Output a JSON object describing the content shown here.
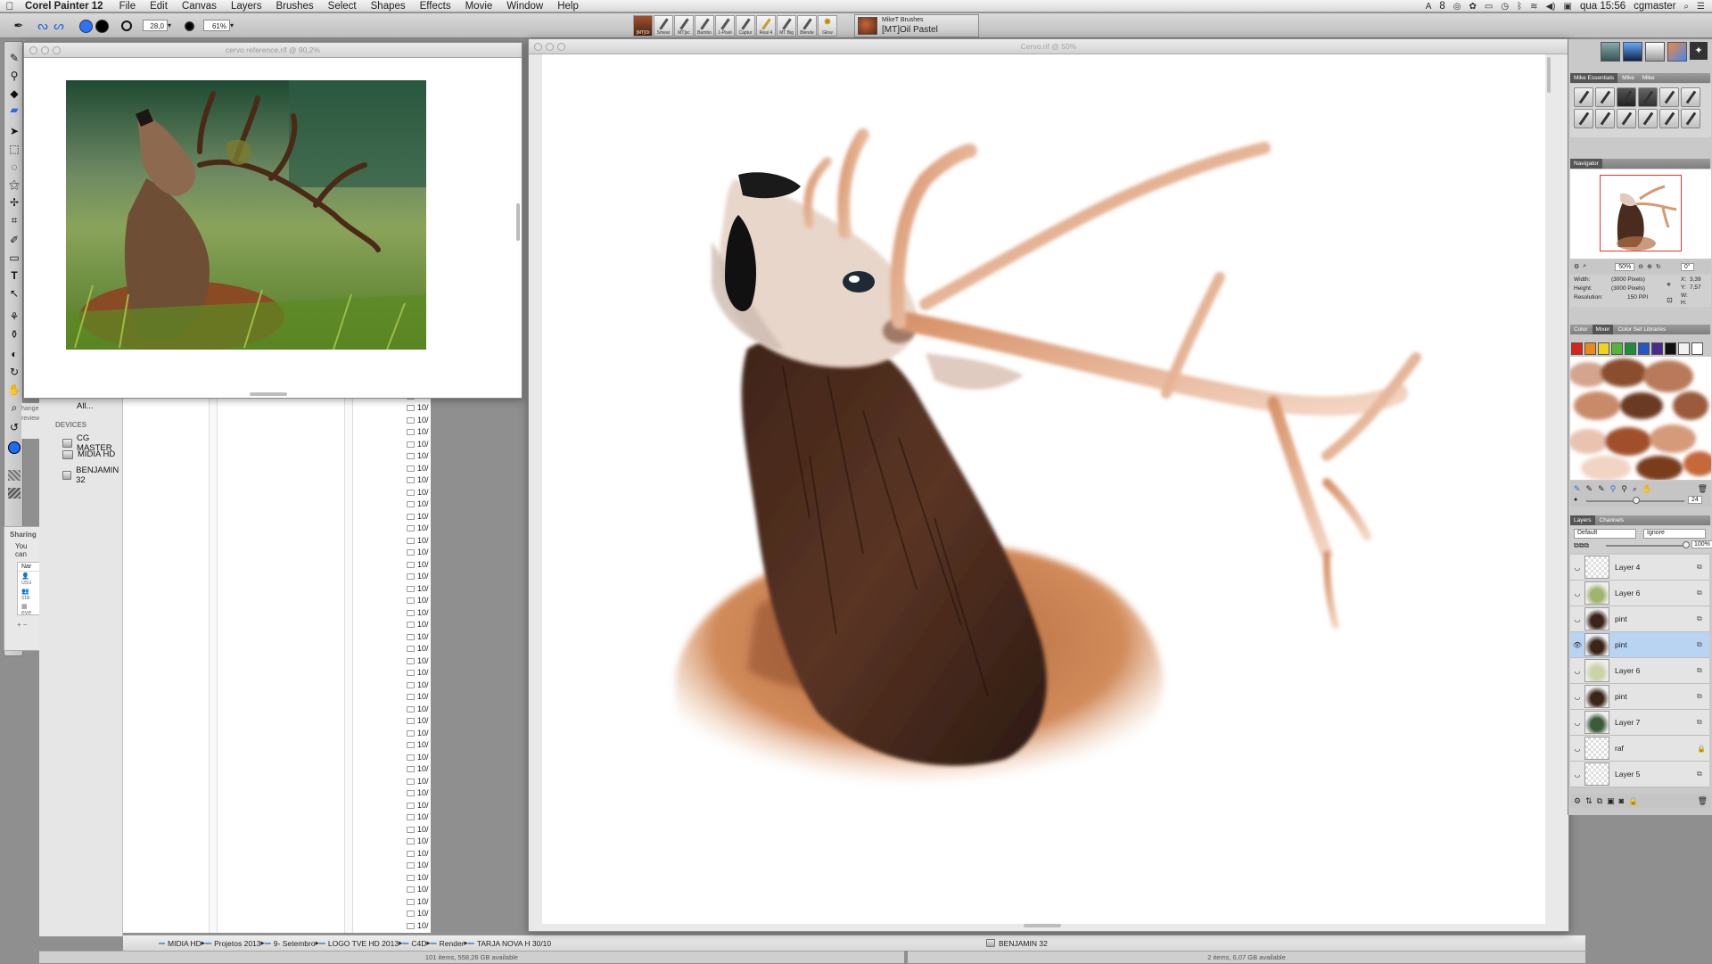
{
  "menubar": {
    "app_name": "Corel Painter 12",
    "items": [
      "File",
      "Edit",
      "Canvas",
      "Layers",
      "Brushes",
      "Select",
      "Shapes",
      "Effects",
      "Movie",
      "Window",
      "Help"
    ],
    "status_count": "8",
    "clock": "qua 15:56",
    "user": "cgmaster"
  },
  "propbar": {
    "size_value": "28,0",
    "opacity_value": "61%",
    "brush_slots": [
      "[MT]Oi",
      "Smear",
      "MT]sc",
      "Bambo",
      "1-Pixel",
      "Captur",
      "Real 4",
      "MT Big",
      "Blende",
      "Glow"
    ],
    "library_title": "MikeT Brushes",
    "brush_name": "[MT]Oil Pastel"
  },
  "ref_window": {
    "title": "cervo reference.rif @ 90,2%"
  },
  "main_window": {
    "title": "Cervo.rif @ 50%"
  },
  "finder": {
    "all_label": "All...",
    "devices_header": "DEVICES",
    "devices": [
      "CG MASTER",
      "MIDIA HD",
      "BENJAMIN 32"
    ],
    "date_prefix": "10/",
    "sharing_title": "Sharing",
    "sharing_text": "You can",
    "sharing_col": "Nar",
    "sharing_users": [
      "usu",
      "sta",
      "eve"
    ],
    "side_fragments": [
      "hange",
      "review"
    ],
    "path": [
      "MIDIA HD",
      "Projetos 2013",
      "9- Setembro",
      "LOGO TVE HD 2013",
      "C4D",
      "Render",
      "TARJA NOVA H 30/10"
    ],
    "status_left": "101 items, 558,26 GB available",
    "path_right": "BENJAMIN 32",
    "status_right": "2 items, 6,07 GB available"
  },
  "panels": {
    "brush_tabs": [
      "Mike Essentials",
      "Mike",
      "Mike"
    ],
    "navigator_title": "Navigator",
    "nav_zoom": "50%",
    "nav_angle": "0°",
    "info": {
      "width_label": "Width:",
      "width_value": "(3000 Pixels)",
      "height_label": "Height:",
      "height_value": "(3000 Pixels)",
      "res_label": "Resolution:",
      "res_value": "150 PPI",
      "x_label": "X:",
      "x_value": "3,39",
      "y_label": "Y:",
      "y_value": "7,57",
      "w_label": "W:",
      "h_label": "H:"
    },
    "color_tabs": [
      "Color",
      "Mixer",
      "Color Set Libraries"
    ],
    "mixer_swatches": [
      "#d8231b",
      "#e98a1a",
      "#efd41c",
      "#57b43a",
      "#1f8d3c",
      "#2757c5",
      "#4a2b8c",
      "#111111",
      "#f2f2f2",
      "#ffffff"
    ],
    "mixer_value": "24",
    "layers_tabs": [
      "Layers",
      "Channels"
    ],
    "blend_mode": "Default",
    "composite": "Ignore",
    "layer_opacity": "100%",
    "layers": [
      {
        "name": "Layer 4",
        "selected": false,
        "locked": false
      },
      {
        "name": "Layer 6",
        "selected": false,
        "locked": false
      },
      {
        "name": "pint",
        "selected": false,
        "locked": false
      },
      {
        "name": "pint",
        "selected": true,
        "locked": false
      },
      {
        "name": "Layer 6",
        "selected": false,
        "locked": false
      },
      {
        "name": "pint",
        "selected": false,
        "locked": false
      },
      {
        "name": "Layer 7",
        "selected": false,
        "locked": false
      },
      {
        "name": "raf",
        "selected": false,
        "locked": true
      },
      {
        "name": "Layer 5",
        "selected": false,
        "locked": false
      }
    ]
  },
  "colors": {
    "primary": "#2b73ff",
    "secondary": "#000000",
    "selection": "#b9d3f3"
  }
}
